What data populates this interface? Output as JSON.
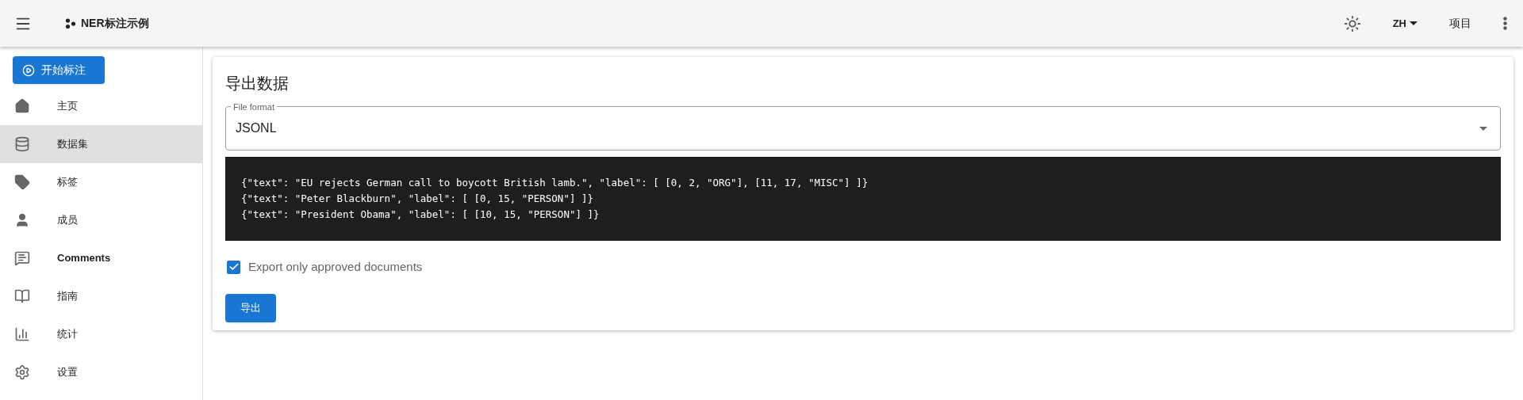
{
  "app_bar": {
    "title": "NER标注示例",
    "language": "ZH",
    "projects_link": "项目"
  },
  "sidebar": {
    "start_button": "开始标注",
    "items": [
      {
        "kind": "home",
        "label": "主页",
        "selected": false
      },
      {
        "kind": "database",
        "label": "数据集",
        "selected": true
      },
      {
        "kind": "label",
        "label": "标签",
        "selected": false
      },
      {
        "kind": "person",
        "label": "成员",
        "selected": false
      },
      {
        "kind": "comment",
        "label": "Comments",
        "selected": false
      },
      {
        "kind": "book",
        "label": "指南",
        "selected": false
      },
      {
        "kind": "chart",
        "label": "统计",
        "selected": false
      },
      {
        "kind": "settings",
        "label": "设置",
        "selected": false
      }
    ]
  },
  "export_card": {
    "title": "导出数据",
    "file_format": {
      "label": "File format",
      "value": "JSONL"
    },
    "preview_lines": [
      "{\"text\": \"EU rejects German call to boycott British lamb.\", \"label\": [ [0, 2, \"ORG\"], [11, 17, \"MISC\"] ]}",
      "{\"text\": \"Peter Blackburn\", \"label\": [ [0, 15, \"PERSON\"] ]}",
      "{\"text\": \"President Obama\", \"label\": [ [10, 15, \"PERSON\"] ]}"
    ],
    "approved_only": {
      "label": "Export only approved documents",
      "checked": true
    },
    "export_button": "导出"
  }
}
